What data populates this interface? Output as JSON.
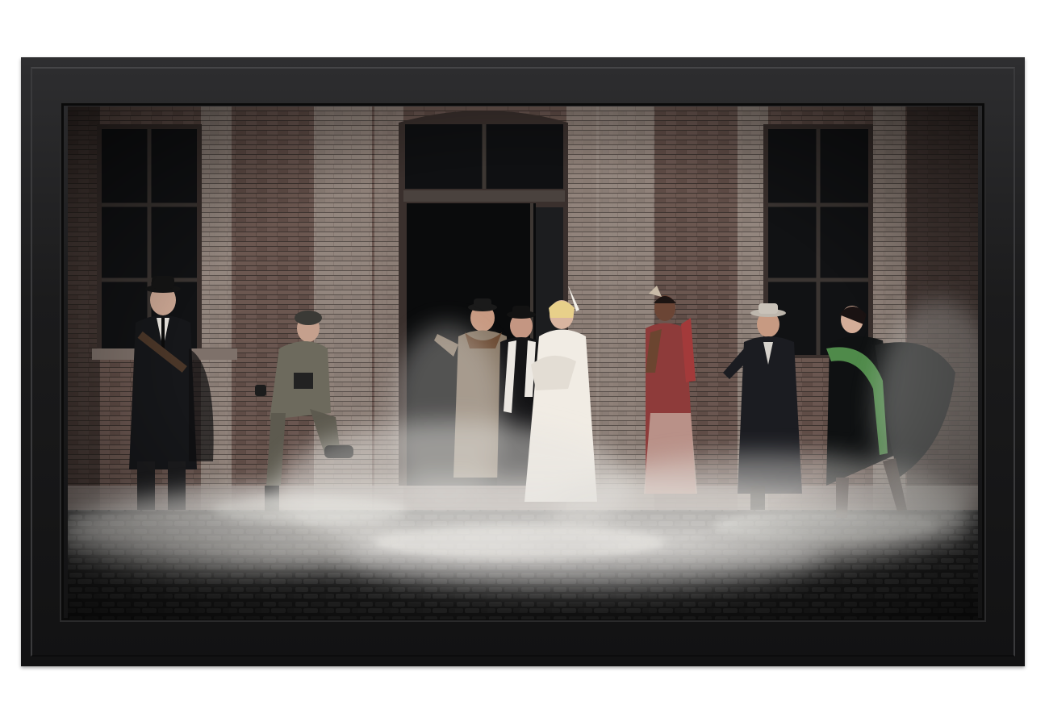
{
  "artwork": {
    "subject": "",
    "frame_color": "#1a1a1b",
    "palette": {
      "brick": "#5a4842",
      "brick_dark": "#2f2725",
      "window": "#111214",
      "cobble": "#3c3c3c",
      "smoke": "#e6e4e0",
      "coat_red": "#a33a3a",
      "boa_green": "#4f8a4a",
      "fur_white": "#f1ece4"
    }
  }
}
